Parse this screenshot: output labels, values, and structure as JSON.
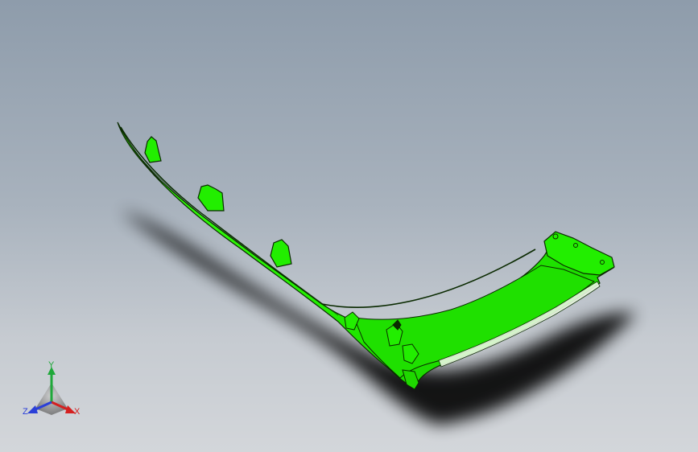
{
  "viewport": {
    "background_top": "#8e9cab",
    "background_bottom": "#d3d6da"
  },
  "model": {
    "part": "bumper-trim-part",
    "color": "#22ee00",
    "edge_color": "#0a2a00"
  },
  "triad": {
    "x_label": "X",
    "y_label": "Y",
    "z_label": "Z",
    "x_color": "#d42020",
    "y_color": "#1fa83a",
    "z_color": "#2a3fd8"
  }
}
